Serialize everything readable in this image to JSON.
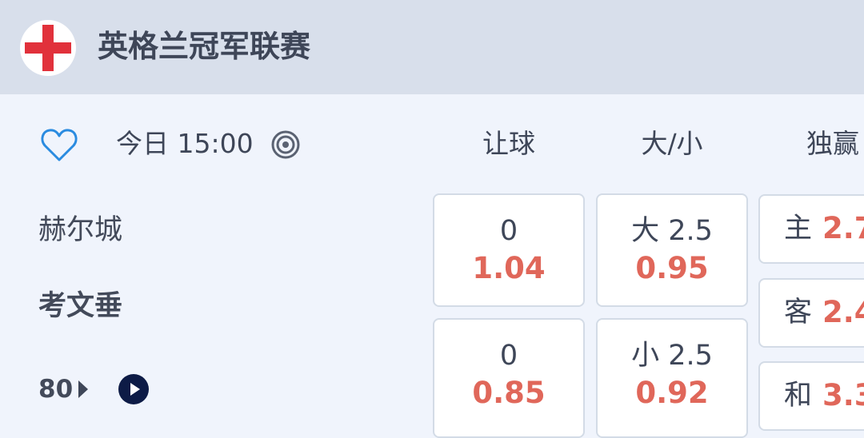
{
  "header": {
    "league": "英格兰冠军联赛"
  },
  "match": {
    "time": "今日 15:00",
    "home": "赫尔城",
    "away": "考文垂",
    "minute": "80"
  },
  "columns": {
    "handicap": "让球",
    "over_under": "大/小",
    "win": "独赢"
  },
  "handicap": [
    {
      "line": "0",
      "price": "1.04"
    },
    {
      "line": "0",
      "price": "0.85"
    }
  ],
  "over_under": [
    {
      "line": "大 2.5",
      "price": "0.95"
    },
    {
      "line": "小 2.5",
      "price": "0.92"
    }
  ],
  "win": [
    {
      "label": "主",
      "price": "2.7"
    },
    {
      "label": "客",
      "price": "2.4"
    },
    {
      "label": "和",
      "price": "3.3"
    }
  ],
  "colors": {
    "accent_red": "#e0675a",
    "flag_red": "#e1313b",
    "header_bg": "#d8dfeb",
    "page_bg": "#f0f4fc"
  }
}
